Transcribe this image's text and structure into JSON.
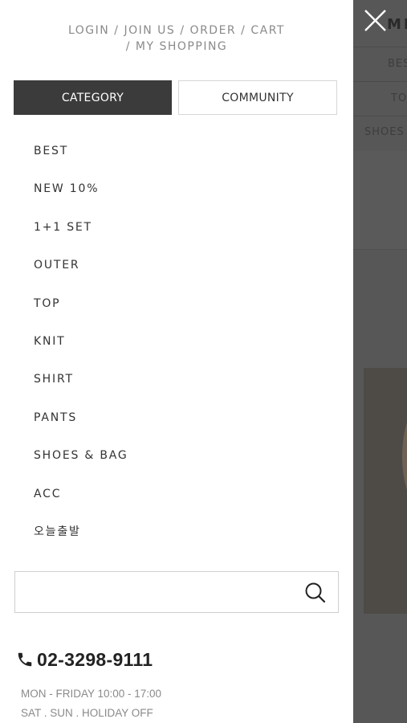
{
  "top_links": {
    "login": "LOGIN",
    "join": "JOIN US",
    "order": "ORDER",
    "cart": "CART",
    "my_shopping": "MY SHOPPING",
    "separator": "/"
  },
  "tabs": {
    "category": "CATEGORY",
    "community": "COMMUNITY"
  },
  "categories": [
    {
      "label": "BEST"
    },
    {
      "label": "NEW 10%"
    },
    {
      "label": "1+1 SET"
    },
    {
      "label": "OUTER"
    },
    {
      "label": "TOP"
    },
    {
      "label": "KNIT"
    },
    {
      "label": "SHIRT"
    },
    {
      "label": "PANTS"
    },
    {
      "label": "SHOES & BAG"
    },
    {
      "label": "ACC"
    },
    {
      "label": "오늘출발"
    }
  ],
  "search": {
    "value": "",
    "placeholder": ""
  },
  "contact": {
    "phone": "02-3298-9111",
    "hours_weekday": "MON - FRIDAY 10:00 - 17:00",
    "hours_weekend": "SAT . SUN . HOLIDAY OFF"
  },
  "background_page": {
    "logo_partial": "MR",
    "nav_best_partial": "BES",
    "nav_top_partial": "TO",
    "nav_shoes_partial": "SHOES"
  },
  "icons": {
    "close": "close-icon",
    "search": "search-icon",
    "phone": "phone-icon"
  },
  "colors": {
    "overlay": "#555555",
    "tab_active_bg": "#3b3b3b",
    "text_dark": "#333333",
    "text_muted": "#8a8a8a"
  }
}
